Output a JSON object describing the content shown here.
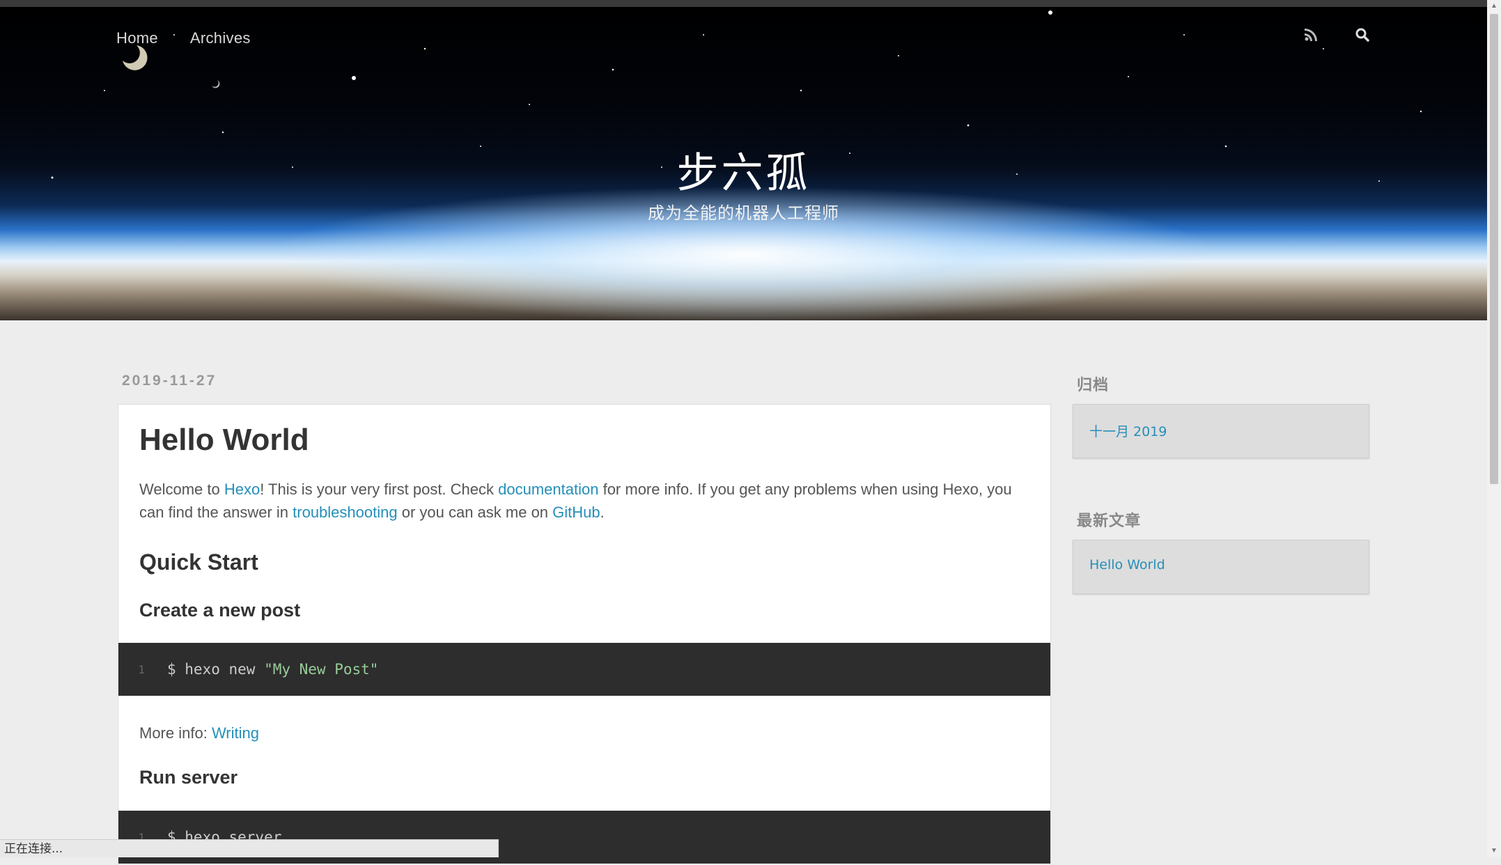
{
  "nav": {
    "items": [
      "Home",
      "Archives"
    ]
  },
  "header_icons": [
    "rss-icon",
    "search-icon"
  ],
  "site": {
    "title": "步六孤",
    "subtitle": "成为全能的机器人工程师"
  },
  "post": {
    "date": "2019-11-27",
    "title": "Hello World",
    "intro": {
      "t1": "Welcome to ",
      "l1": "Hexo",
      "t2": "! This is your very first post. Check ",
      "l2": "documentation",
      "t3": " for more info. If you get any problems when using Hexo, you can find the answer in ",
      "l3": "troubleshooting",
      "t4": " or you can ask me on ",
      "l4": "GitHub",
      "t5": "."
    },
    "quick_start": "Quick Start",
    "create_post": "Create a new post",
    "code1": {
      "line": "1",
      "cmd": "$ hexo new ",
      "str": "\"My New Post\""
    },
    "more_info": {
      "label": "More info: ",
      "link": "Writing"
    },
    "run_server": "Run server",
    "code2": {
      "line": "1",
      "cmd": "$ hexo server"
    }
  },
  "sidebar": {
    "archive_title": "归档",
    "archive_link": "十一月 2019",
    "recent_title": "最新文章",
    "recent_link": "Hello World"
  },
  "status_bar": "正在连接...",
  "colors": {
    "link": "#258fb8",
    "code_bg": "#2d2d2d",
    "code_string": "#99cc99",
    "page_bg": "#ededed"
  }
}
